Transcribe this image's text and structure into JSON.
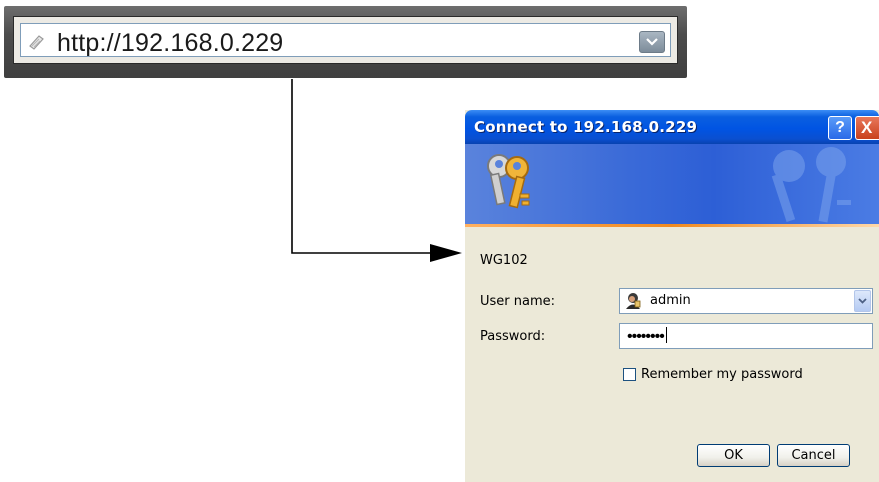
{
  "address_bar": {
    "url": "http://192.168.0.229",
    "page_icon": "page-icon",
    "dropdown_icon": "chevron-down-icon"
  },
  "dialog": {
    "title": "Connect to 192.168.0.229",
    "help_button": "?",
    "close_button": "X",
    "banner_icon": "keys-icon",
    "realm": "WG102",
    "username_label": "User name:",
    "username_value": "admin",
    "password_label": "Password:",
    "password_value": "••••••••",
    "remember_label": "Remember my password",
    "remember_checked": false,
    "ok_label": "OK",
    "cancel_label": "Cancel"
  },
  "colors": {
    "titlebar": "#0054e3",
    "dialog_bg": "#ece9d8",
    "banner_accent": "#f08a20"
  }
}
